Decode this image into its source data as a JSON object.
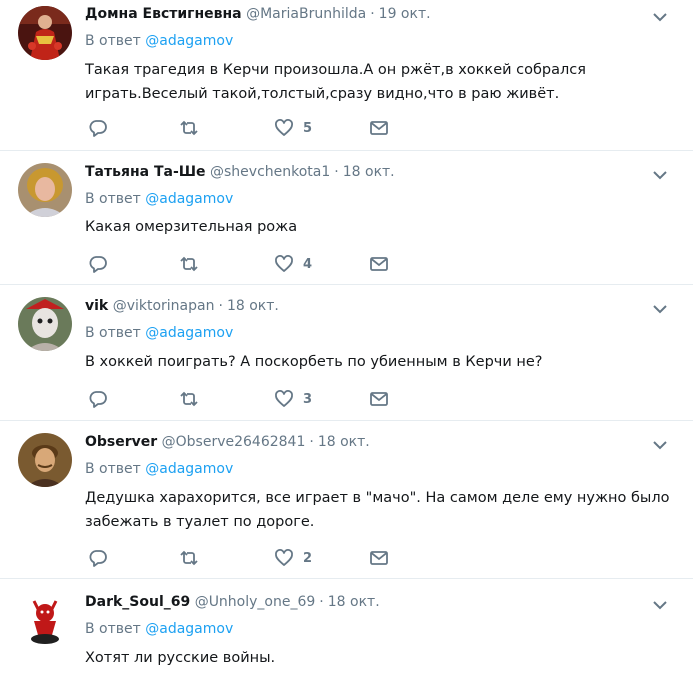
{
  "reply_prefix": "В ответ",
  "tweets": [
    {
      "name": "Домна Евстигневна",
      "handle": "@MariaBrunhilda",
      "separator": "·",
      "time": "19 окт.",
      "reply_to": "@adagamov",
      "text": "Такая трагедия в Керчи произошла.А он ржёт,в хоккей собрался играть.Веселый такой,толстый,сразу видно,что в раю живёт.",
      "likes": "5"
    },
    {
      "name": "Татьяна Та-Ше",
      "handle": "@shevchenkota1",
      "separator": "·",
      "time": "18 окт.",
      "reply_to": "@adagamov",
      "text": "Какая омерзительная рожа",
      "likes": "4"
    },
    {
      "name": "vik",
      "handle": "@viktorinapan",
      "separator": "·",
      "time": "18 окт.",
      "reply_to": "@adagamov",
      "text": "В хоккей поиграть? А поскорбеть по убиенным в Керчи не?",
      "likes": "3"
    },
    {
      "name": "Observer",
      "handle": "@Observe26462841",
      "separator": "·",
      "time": "18 окт.",
      "reply_to": "@adagamov",
      "text": "Дедушка харахорится, все играет в \"мачо\". На самом деле ему нужно было забежать в туалет по дороге.",
      "likes": "2"
    },
    {
      "name": "Dark_Soul_69",
      "handle": "@Unholy_one_69",
      "separator": "·",
      "time": "18 окт.",
      "reply_to": "@adagamov",
      "text": "Хотят ли русские войны.",
      "likes": ""
    }
  ],
  "colors": {
    "link": "#1da1f2",
    "muted": "#657786",
    "divider": "#e6ecf0",
    "text": "#14171a"
  },
  "icons": [
    "reply-icon",
    "retweet-icon",
    "like-icon",
    "direct-message-icon",
    "chevron-down-icon"
  ]
}
